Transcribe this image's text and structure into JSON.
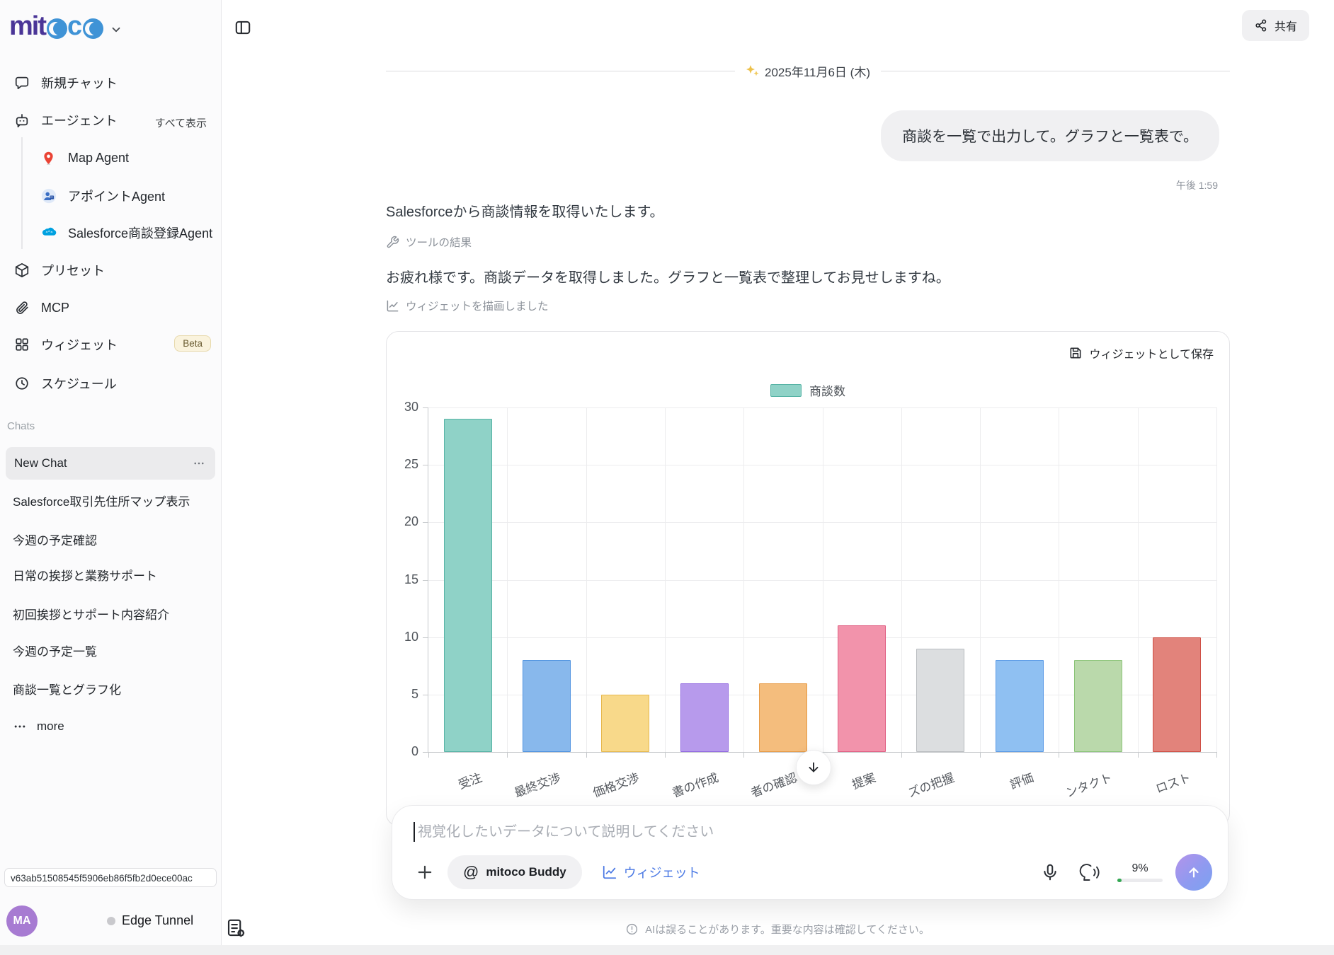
{
  "sidebar": {
    "logo": {
      "mit": "mit",
      "c": "c",
      "full_name": "mitoco"
    },
    "nav": {
      "new_chat": "新規チャット",
      "agents": "エージェント",
      "show_all": "すべて表示",
      "agent_items": [
        "Map Agent",
        "アポイントAgent",
        "Salesforce商談登録Agent"
      ],
      "presets": "プリセット",
      "mcp": "MCP",
      "widgets": "ウィジェット",
      "beta_badge": "Beta",
      "schedule": "スケジュール"
    },
    "chats_label": "Chats",
    "chats": [
      "New Chat",
      "Salesforce取引先住所マップ表示",
      "今週の予定確認",
      "日常の挨拶と業務サポート",
      "初回挨拶とサポート内容紹介",
      "今週の予定一覧",
      "商談一覧とグラフ化"
    ],
    "more_label": "more",
    "session_token": "v63ab51508545f5906eb86f5fb2d0ece00ac",
    "user": {
      "avatar_initials": "MA",
      "tunnel_label": "Edge Tunnel"
    }
  },
  "header": {
    "share_label": "共有"
  },
  "conversation": {
    "date_divider": "2025年11月6日 (木)",
    "user_message": "商談を一覧で出力して。グラフと一覧表で。",
    "user_timestamp": "午後 1:59",
    "assistant_intro": "Salesforceから商談情報を取得いたします。",
    "tool_result_label": "ツールの結果",
    "assistant_followup": "お疲れ様です。商談データを取得しました。グラフと一覧表で整理してお見せしますね。",
    "widget_drawn_label": "ウィジェットを描画しました",
    "save_widget_label": "ウィジェットとして保存"
  },
  "chart_data": {
    "type": "bar",
    "title": "",
    "categories": [
      "受注",
      "最終交渉",
      "価格交渉",
      "書の作成",
      "者の確認",
      "提案",
      "ズの把握",
      "評価",
      "ンタクト",
      "ロスト"
    ],
    "series": [
      {
        "name": "商談数",
        "values": [
          29,
          8,
          5,
          6,
          6,
          11,
          9,
          8,
          8,
          10
        ]
      }
    ],
    "ylim": [
      0,
      30
    ],
    "yticks": [
      0,
      5,
      10,
      15,
      20,
      25,
      30
    ],
    "grid": true,
    "legend_position": "top-center",
    "x_label_rotation_deg": -20,
    "bar_fill_colors": [
      "#8fd2c7",
      "#88b8ec",
      "#f8d98a",
      "#b79aec",
      "#f4bd7d",
      "#f293ab",
      "#dcdee0",
      "#8fc0f2",
      "#bad9ab",
      "#e2837b"
    ],
    "bar_border_colors": [
      "#56b3a5",
      "#4f93e0",
      "#e6b84e",
      "#9169e0",
      "#e79a45",
      "#e05f83",
      "#b9bcc0",
      "#5a9ae6",
      "#8bc478",
      "#cf4f45"
    ]
  },
  "composer": {
    "placeholder": "視覚化したいデータについて説明してください",
    "at_symbol": "@",
    "buddy_label": "mitoco Buddy",
    "widget_label": "ウィジェット",
    "usage_percent": "9%"
  },
  "footer": {
    "disclaimer": "AIは誤ることがあります。重要な内容は確認してください。"
  },
  "colors": {
    "accent_blue": "#4b79e4",
    "legend_teal": "#8fd2c7",
    "avatar_purple": "#a77bd2",
    "send_gradient_start": "#b493ea",
    "send_gradient_end": "#7ba2f1"
  }
}
